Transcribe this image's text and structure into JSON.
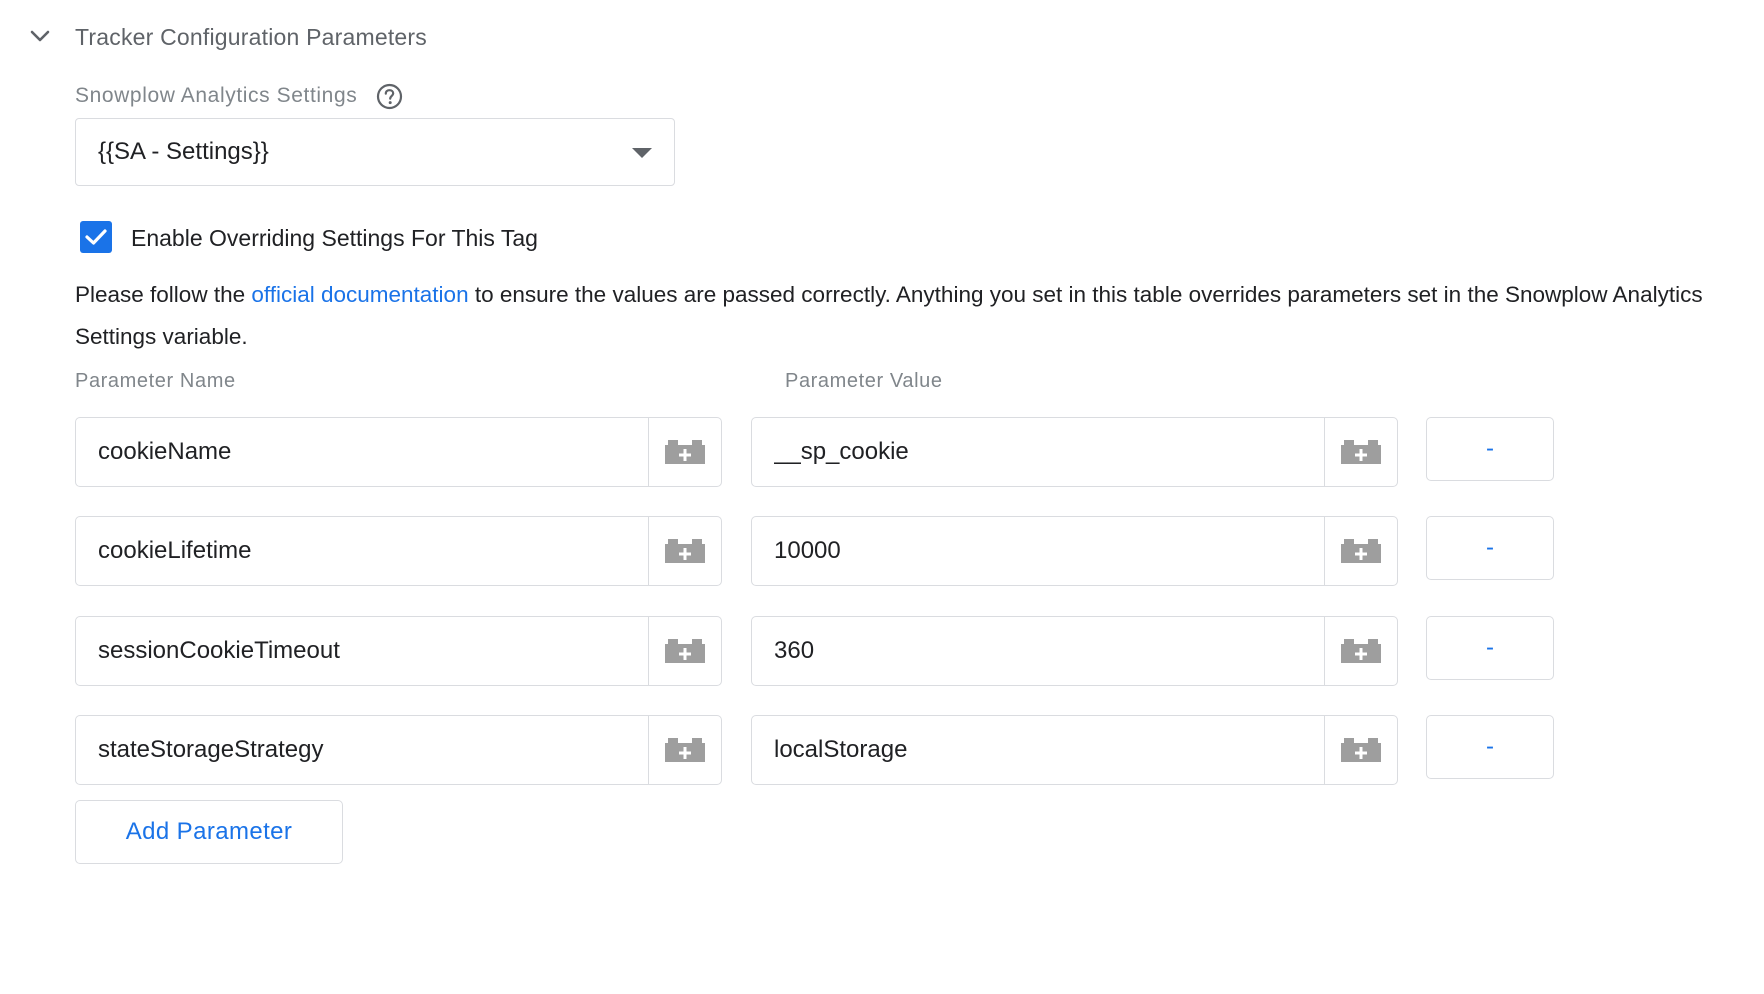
{
  "section": {
    "title": "Tracker Configuration Parameters"
  },
  "settings": {
    "label": "Snowplow Analytics Settings",
    "selected_value": "{{SA - Settings}}"
  },
  "override": {
    "checked": true,
    "label": "Enable Overriding Settings For This Tag"
  },
  "description": {
    "before_link": "Please follow the ",
    "link_text": "official documentation",
    "after_link": " to ensure the values are passed correctly. Anything you set in this table overrides parameters set in the Snowplow Analytics Settings variable."
  },
  "table": {
    "name_header": "Parameter Name",
    "value_header": "Parameter Value",
    "remove_label": "-",
    "rows": [
      {
        "name": "cookieName",
        "value": "__sp_cookie"
      },
      {
        "name": "cookieLifetime",
        "value": "10000"
      },
      {
        "name": "sessionCookieTimeout",
        "value": "360"
      },
      {
        "name": "stateStorageStrategy",
        "value": "localStorage"
      }
    ]
  },
  "add_button_label": "Add Parameter",
  "colors": {
    "accent": "#1a73e8",
    "border": "#dadce0",
    "muted_text": "#80868b",
    "icon_gray": "#9e9e9e"
  }
}
